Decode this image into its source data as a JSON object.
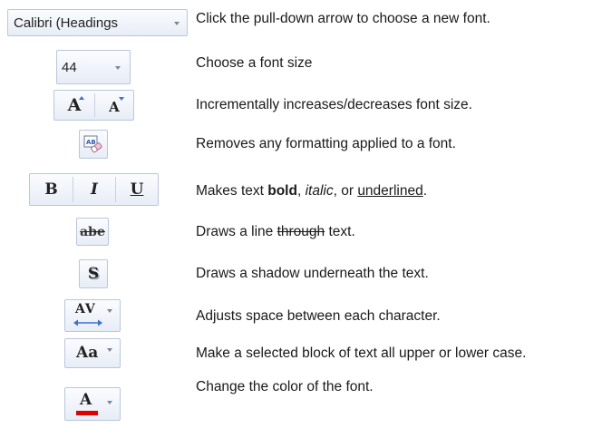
{
  "rows": [
    {
      "control": {
        "value": "Calibri (Headings"
      },
      "desc": "Click the pull-down arrow to choose a new font."
    },
    {
      "control": {
        "value": "44"
      },
      "desc": "Choose a font size"
    },
    {
      "control": {
        "grow_label": "A",
        "shrink_label": "A"
      },
      "desc": "Incrementally increases/decreases font size."
    },
    {
      "control": {
        "icon": "clear-formatting-icon"
      },
      "desc": "Removes any formatting applied to a font."
    },
    {
      "control": {
        "bold_label": "B",
        "italic_label": "I",
        "underline_label": "U"
      },
      "desc_parts": {
        "before": "Makes text ",
        "bold": "bold",
        "sep1": ", ",
        "italic": "italic",
        "sep2": ", or ",
        "underline": "underlined",
        "after": "."
      }
    },
    {
      "control": {
        "label": "abe"
      },
      "desc_parts": {
        "before": "Draws a line ",
        "strike": "through",
        "after": " text."
      }
    },
    {
      "control": {
        "label": "S"
      },
      "desc": "Draws a shadow underneath the text."
    },
    {
      "control": {
        "label": "AV"
      },
      "desc": "Adjusts space between each character."
    },
    {
      "control": {
        "label": "Aa"
      },
      "desc": "Make a selected block of text all upper or lower case."
    },
    {
      "control": {
        "label": "A",
        "underline_color": "#e00000"
      },
      "desc": "Change the color of the font."
    }
  ],
  "colors": {
    "control_border": "#b9c7dc",
    "accent_blue": "#3a6fd8",
    "font_color_bar": "#e00000"
  }
}
